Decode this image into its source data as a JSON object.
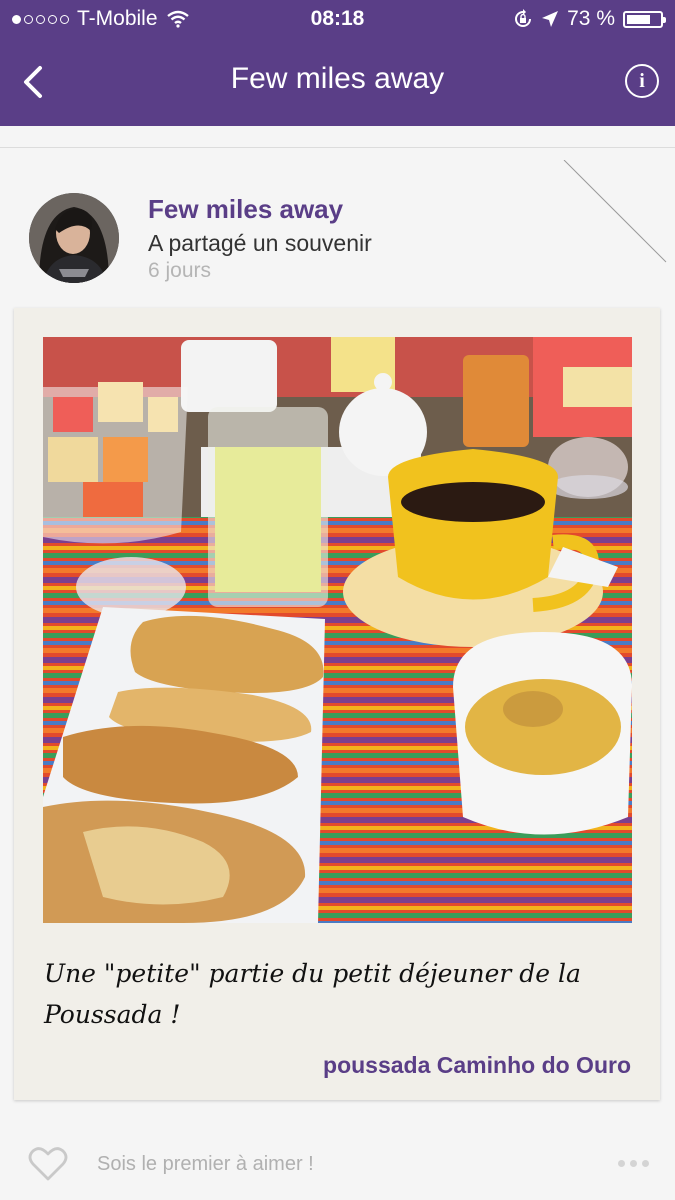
{
  "status_bar": {
    "carrier": "T-Mobile",
    "time": "08:18",
    "battery_percent": "73 %",
    "battery_level": 0.73,
    "signal_bars_filled": 1,
    "signal_bars_total": 5
  },
  "nav": {
    "title": "Few miles away"
  },
  "post": {
    "author": "Few miles away",
    "action": "A partagé un souvenir",
    "time_ago": "6 jours",
    "caption": "Une \"petite\" partie du petit déjeuner de la Poussada !",
    "place": "poussada Caminho do Ouro"
  },
  "footer": {
    "likes_text": "Sois le premier à aimer !"
  },
  "colors": {
    "brand": "#5a3e87",
    "card": "#f1efe9"
  },
  "icons": [
    "back-chevron-icon",
    "info-icon",
    "heart-icon",
    "more-dots-icon",
    "wifi-icon",
    "location-arrow-icon",
    "rotation-lock-icon"
  ]
}
